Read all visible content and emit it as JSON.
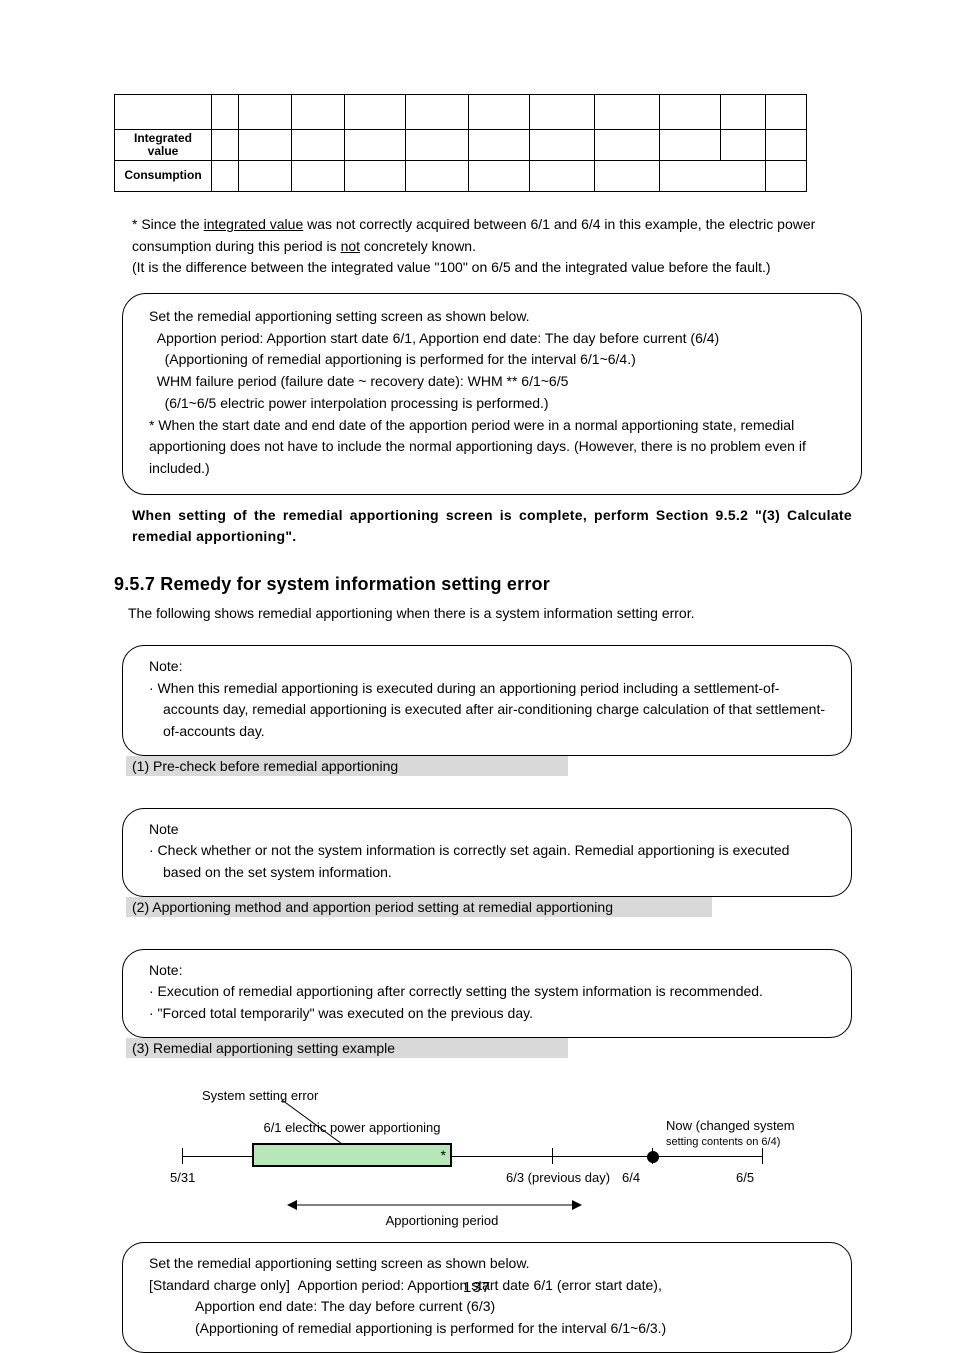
{
  "page_number": "137",
  "table_top": {
    "row_labels": {
      "integrated": "Integrated value",
      "consumption": "Consumption"
    }
  },
  "notes": {
    "line1_a": "* Since the ",
    "line1_u": "integrated value",
    "line1_b": " was not correctly acquired between 6/1 and 6/4 in this example, the electric power consumption during this period is ",
    "line1_nc": "not",
    "line1_c": " concretely known.",
    "line2": "(It is the difference between the integrated value \"100\" on 6/5 and the integrated value before the fault.)"
  },
  "remedy_box1": {
    "l1": "Set the remedial apportioning setting screen as shown below.",
    "l2": "Apportion period: Apportion start date 6/1, Apportion end date: The day before current (6/4)",
    "l3": "(Apportioning of remedial apportioning is performed for the interval 6/1~6/4.)",
    "l4": "WHM failure period (failure date ~ recovery date): WHM ** 6/1~6/5",
    "l5": "(6/1~6/5 electric power interpolation processing is performed.)",
    "l6": "* When the start date and end date of the apportion period were in a normal apportioning state, remedial apportioning does not have to include the normal apportioning days. (However, there is no problem even if included.)"
  },
  "bold_follow": "When setting of the remedial apportioning screen is complete, perform Section 9.5.2 \"(3) Calculate remedial apportioning\".",
  "section": {
    "num": "9.5.7",
    "title": "Remedy for system information setting error",
    "intro": "The following shows remedial apportioning when there is a system information setting error."
  },
  "note_box1": {
    "l1": "Note:",
    "l2": "· When this remedial apportioning is executed during an apportioning period including a settlement-of-accounts day, remedial apportioning is executed after air-conditioning charge calculation of that settlement-of-accounts day."
  },
  "banner1": "(1) Pre-check before remedial apportioning",
  "note_box2": {
    "l1": "Note",
    "l2": "· Check whether or not the system information is correctly set again. Remedial apportioning is executed based on the set system information."
  },
  "banner2": "(2) Apportioning method and apportion period setting at remedial apportioning",
  "note_box3": {
    "l1": "Note:",
    "l2": "· Execution of remedial apportioning after correctly setting the system information is recommended.",
    "l3": "· \"Forced total temporarily\" was executed on the previous day."
  },
  "banner3": "(3) Remedial apportioning setting example",
  "diagram": {
    "bar_label": "6/1 electric power apportioning",
    "err_label": "System setting error",
    "star": "*",
    "now_label_1": "Now (changed system",
    "now_label_2": "setting contents on 6/4)",
    "span_label": "Apportioning period",
    "ticks": {
      "c1": "5/31",
      "c2": "6/3 (previous day)",
      "c3": "6/4",
      "c4": "6/5"
    }
  },
  "remedy_box_final": {
    "l1": "Set the remedial apportioning setting screen as shown below.",
    "l2a": "[Standard charge only]",
    "l2b": "Apportion period: Apportion start date 6/1 (error start date),",
    "l2c": "Apportion end date: The day before current (6/3)",
    "l3": "(Apportioning of remedial apportioning is performed for the interval 6/1~6/3.)"
  }
}
